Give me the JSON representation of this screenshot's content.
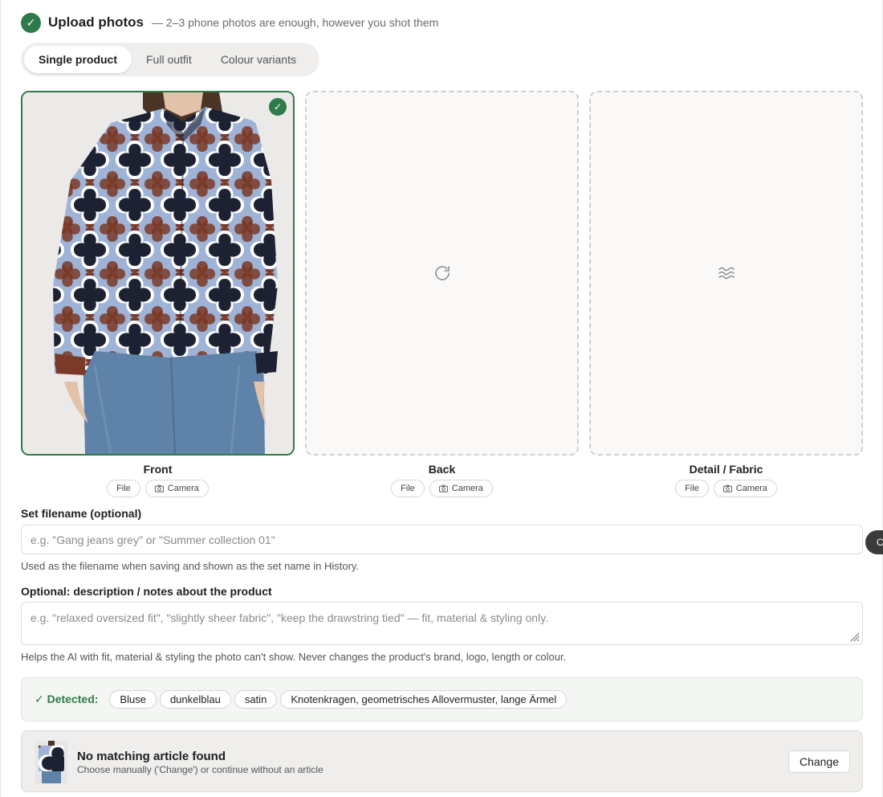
{
  "header": {
    "title": "Upload photos",
    "subtitle": "— 2–3 phone photos are enough, however you shot them"
  },
  "mode_tabs": [
    {
      "label": "Single product",
      "active": true
    },
    {
      "label": "Full outfit",
      "active": false
    },
    {
      "label": "Colour variants",
      "active": false
    }
  ],
  "slots": [
    {
      "label": "Front",
      "file_label": "File",
      "camera_label": "Camera",
      "filled": true,
      "icon": "photo-thumbnail"
    },
    {
      "label": "Back",
      "file_label": "File",
      "camera_label": "Camera",
      "filled": false,
      "icon": "rotate-icon"
    },
    {
      "label": "Detail / Fabric",
      "file_label": "File",
      "camera_label": "Camera",
      "filled": false,
      "icon": "fabric-waves-icon"
    }
  ],
  "filename": {
    "label": "Set filename (optional)",
    "placeholder": "e.g. \"Gang jeans grey\" or \"Summer collection 01\"",
    "help": "Used as the filename when saving and shown as the set name in History."
  },
  "notes": {
    "label": "Optional: description / notes about the product",
    "placeholder": "e.g. \"relaxed oversized fit\", \"slightly sheer fabric\", \"keep the drawstring tied\" — fit, material & styling only.",
    "help": "Helps the AI with fit, material & styling the photo can't show. Never changes the product's brand, logo, length or colour."
  },
  "detected": {
    "label": "✓ Detected:",
    "tags": [
      "Bluse",
      "dunkelblau",
      "satin",
      "Knotenkragen, geometrisches Allovermuster, lange Ärmel"
    ]
  },
  "article": {
    "title": "No matching article found",
    "subtitle": "Choose manually ('Change') or continue without an article",
    "button": "Change"
  },
  "side_tab": {
    "label": "C"
  },
  "colors": {
    "accent_green": "#2f7a4a",
    "pattern_navy": "#1d2233",
    "pattern_rust": "#7a3a27",
    "pattern_lightblue": "#9fb3d6",
    "denim": "#5f83a8"
  }
}
